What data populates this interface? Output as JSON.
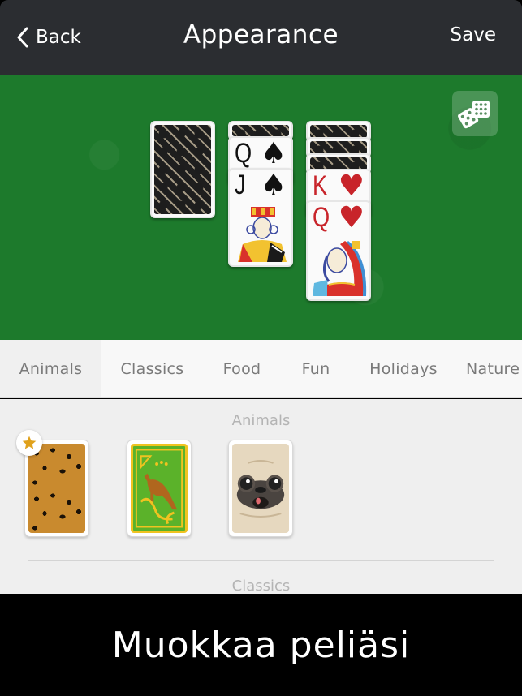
{
  "navbar": {
    "back_label": "Back",
    "title": "Appearance",
    "save_label": "Save",
    "back_icon": "chevron-left-icon"
  },
  "preview": {
    "felt_color": "#1d7a2c",
    "shuffle_icon": "dice-icon",
    "stock_pile": {
      "face_down": 1
    },
    "tableau": [
      {
        "face_down": 1,
        "face_up": [
          {
            "rank": "Q",
            "suit": "♠",
            "color": "black"
          },
          {
            "rank": "J",
            "suit": "♠",
            "color": "black"
          }
        ]
      },
      {
        "face_down": 3,
        "face_up": [
          {
            "rank": "K",
            "suit": "♥",
            "color": "red"
          },
          {
            "rank": "Q",
            "suit": "♥",
            "color": "red"
          }
        ]
      }
    ]
  },
  "tabs": [
    {
      "label": "Animals",
      "active": true
    },
    {
      "label": "Classics",
      "active": false
    },
    {
      "label": "Food",
      "active": false
    },
    {
      "label": "Fun",
      "active": false
    },
    {
      "label": "Holidays",
      "active": false
    },
    {
      "label": "Nature",
      "active": false
    }
  ],
  "sections": [
    {
      "heading": "Animals",
      "items": [
        {
          "name": "leopard-card-back",
          "favorite": true
        },
        {
          "name": "kangaroo-card-back",
          "favorite": false
        },
        {
          "name": "pug-card-back",
          "favorite": false
        }
      ]
    },
    {
      "heading": "Classics",
      "items": []
    }
  ],
  "caption": {
    "text": "Muokkaa peliäsi"
  }
}
